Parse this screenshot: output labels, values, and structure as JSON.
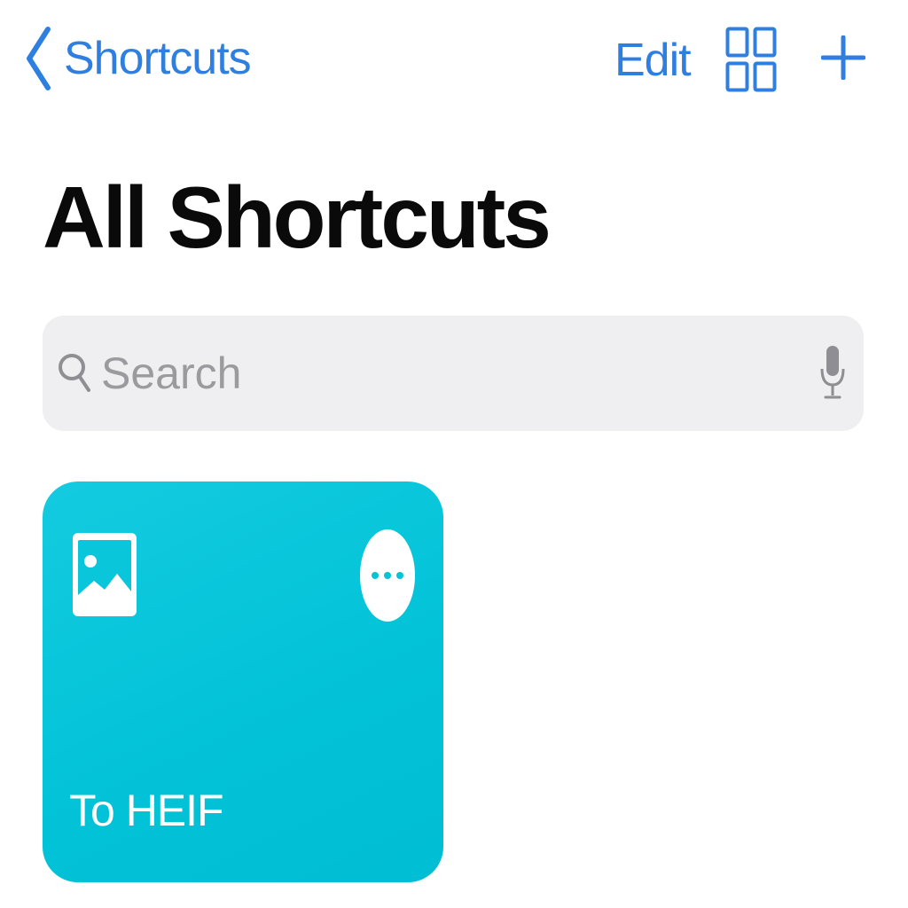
{
  "nav": {
    "back_label": "Shortcuts",
    "edit_label": "Edit"
  },
  "page": {
    "title": "All Shortcuts"
  },
  "search": {
    "placeholder": "Search",
    "value": ""
  },
  "shortcuts": [
    {
      "name": "To HEIF",
      "icon": "photo-icon",
      "color": "#03c3d8"
    }
  ],
  "colors": {
    "accent": "#2f7fe0",
    "search_background": "#efeff1",
    "tile": "#03c3d8"
  },
  "icons": {
    "back": "chevron-left-icon",
    "layout": "grid-icon",
    "add": "plus-icon",
    "search": "search-icon",
    "mic": "microphone-icon",
    "more": "ellipsis-icon"
  }
}
